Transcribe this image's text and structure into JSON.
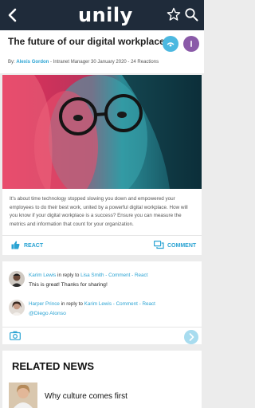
{
  "app": {
    "logo": "unily"
  },
  "article": {
    "title": "The future of our digital workplace",
    "byline_prefix": "By:",
    "author": "Alexis Gordon",
    "byline_rest": " - Intranet Manager  30 January 2020 - 24 Reactions",
    "body": "It's about time technology stopped slowing you down and empowered your employees to do their best work, united by a powerful digital workplace. How will you know if your digital workplace is a success? Ensure you can measure the metrics and information that count for your organization.",
    "react_label": "REACT",
    "comment_label": "COMMENT"
  },
  "comments": [
    {
      "name": "Karim Lewis",
      "reply_text": " in reply to ",
      "reply_to": "Lisa Smith",
      "links": "  -  Comment  -  React",
      "text": "This is great! Thanks for sharing!"
    },
    {
      "name": "Harper Prince",
      "reply_text": " in reply to ",
      "reply_to": "Karim Lewis",
      "links": "  -  Comment  -  React",
      "text": "@Diego Alonso"
    }
  ],
  "related": {
    "heading": "RELATED NEWS",
    "items": [
      {
        "title": "Why culture comes first"
      }
    ]
  },
  "colors": {
    "topbar": "#1f2b3a",
    "accent": "#2aa3d3",
    "share_btn": "#4cb8e0",
    "user_btn": "#8a5aa8"
  }
}
